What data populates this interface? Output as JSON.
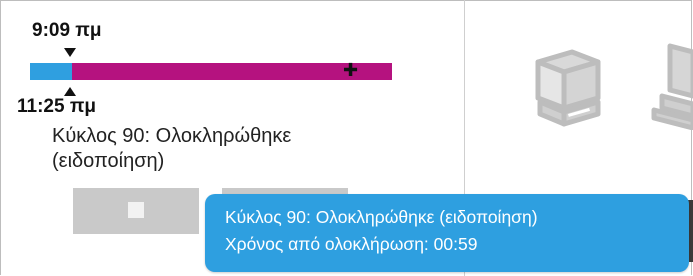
{
  "status_panel": {
    "start_time": "9:09 πμ",
    "end_time": "11:25 πμ",
    "progress_fraction": 0.116,
    "cycle_line1": "Κύκλος 90: Ολοκληρώθηκε",
    "cycle_line2": "(ειδοποίηση)",
    "colors": {
      "elapsed": "#2f9fe0",
      "remaining": "#b5127f"
    }
  },
  "buttons": {
    "stop_icon": "stop-square-icon"
  },
  "devices": {
    "icons": [
      "instrument-icon",
      "workstation-icon"
    ]
  },
  "tooltip": {
    "line1": "Κύκλος 90: Ολοκληρώθηκε (ειδοποίηση)",
    "line2": "Χρόνος από ολοκλήρωση: 00:59",
    "background": "#2e9fe0"
  }
}
